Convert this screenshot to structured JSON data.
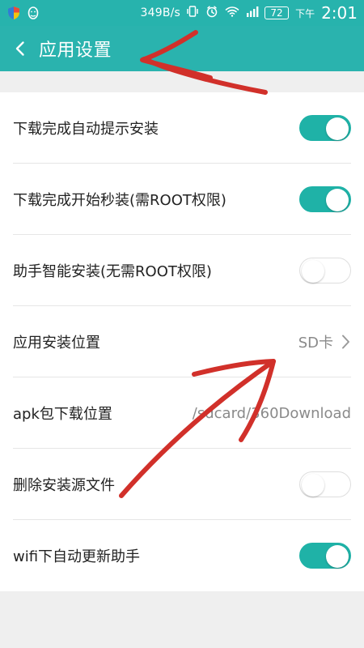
{
  "colors": {
    "status_bar_bg": "#27b3ad",
    "header_bg": "#2ab3ae",
    "toggle_on": "#1fb2a7",
    "annotation_red": "#d1302a"
  },
  "status_bar": {
    "net_speed": "349B/s",
    "battery": "72",
    "ampm": "下午",
    "time": "2:01",
    "icons": [
      "shield-icon",
      "penguin-icon",
      "vibrate-icon",
      "alarm-icon",
      "wifi-icon",
      "signal-icon",
      "battery-icon"
    ]
  },
  "header": {
    "title": "应用设置",
    "back_icon": "chevron-left-icon"
  },
  "settings": [
    {
      "label": "下载完成自动提示安装",
      "control": "toggle",
      "enabled": true
    },
    {
      "label": "下载完成开始秒装(需ROOT权限)",
      "control": "toggle",
      "enabled": true
    },
    {
      "label": "助手智能安装(无需ROOT权限)",
      "control": "toggle",
      "enabled": false
    },
    {
      "label": "应用安装位置",
      "control": "link",
      "value": "SD卡"
    },
    {
      "label": "apk包下载位置",
      "control": "value",
      "value": "/sdcard/360Download"
    },
    {
      "label": "删除安装源文件",
      "control": "toggle",
      "enabled": false
    },
    {
      "label": "wifi下自动更新助手",
      "control": "toggle",
      "enabled": true
    }
  ]
}
